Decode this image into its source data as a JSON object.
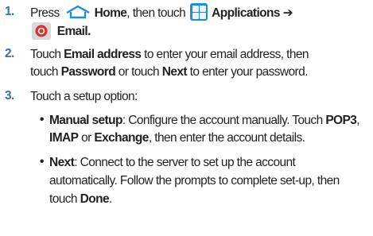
{
  "steps": [
    {
      "number": "1.",
      "press": "Press",
      "home": "Home",
      "then_touch": ", then touch",
      "applications": "Applications",
      "arrow": "➔",
      "email": "Email",
      "period": "."
    },
    {
      "number": "2.",
      "touch": "Touch",
      "email_address": "Email address",
      "mid1": "to enter your email address, then",
      "touch2": "touch",
      "password": "Password",
      "or_touch": "or touch",
      "next": "Next",
      "end": "to enter your password."
    },
    {
      "number": "3.",
      "text": "Touch a setup option:"
    }
  ],
  "options": [
    {
      "bullet": "•",
      "label": "Manual setup",
      "line1": ": Configure the account manually. Touch",
      "pop3": "POP3",
      "comma": ",",
      "imap": "IMAP",
      "or": "or",
      "exchange": "Exchange",
      "line2_end": ", then enter the account details."
    },
    {
      "bullet": "•",
      "label": "Next",
      "line1": ": Connect to the server to set up the account",
      "line2": "automatically. Follow the prompts to complete set-up, then",
      "touch": "touch",
      "done": "Done",
      "period": "."
    }
  ],
  "icons": {
    "home": "home-icon",
    "applications": "applications-grid-icon",
    "email": "email-icon"
  },
  "colors": {
    "step_number": "#3a6ea8",
    "apps_icon": "#1e8fd6",
    "email_icon_red": "#d7332a"
  }
}
